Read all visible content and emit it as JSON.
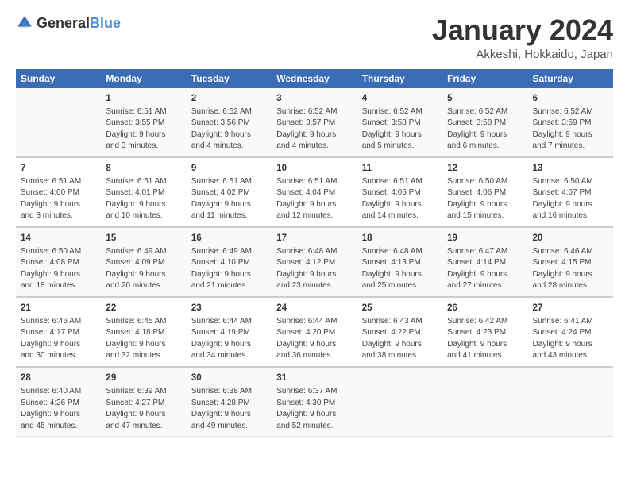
{
  "logo": {
    "text_general": "General",
    "text_blue": "Blue"
  },
  "header": {
    "month": "January 2024",
    "location": "Akkeshi, Hokkaido, Japan"
  },
  "weekdays": [
    "Sunday",
    "Monday",
    "Tuesday",
    "Wednesday",
    "Thursday",
    "Friday",
    "Saturday"
  ],
  "weeks": [
    [
      {
        "day": "",
        "info": ""
      },
      {
        "day": "1",
        "info": "Sunrise: 6:51 AM\nSunset: 3:55 PM\nDaylight: 9 hours\nand 3 minutes."
      },
      {
        "day": "2",
        "info": "Sunrise: 6:52 AM\nSunset: 3:56 PM\nDaylight: 9 hours\nand 4 minutes."
      },
      {
        "day": "3",
        "info": "Sunrise: 6:52 AM\nSunset: 3:57 PM\nDaylight: 9 hours\nand 4 minutes."
      },
      {
        "day": "4",
        "info": "Sunrise: 6:52 AM\nSunset: 3:58 PM\nDaylight: 9 hours\nand 5 minutes."
      },
      {
        "day": "5",
        "info": "Sunrise: 6:52 AM\nSunset: 3:58 PM\nDaylight: 9 hours\nand 6 minutes."
      },
      {
        "day": "6",
        "info": "Sunrise: 6:52 AM\nSunset: 3:59 PM\nDaylight: 9 hours\nand 7 minutes."
      }
    ],
    [
      {
        "day": "7",
        "info": "Sunrise: 6:51 AM\nSunset: 4:00 PM\nDaylight: 9 hours\nand 8 minutes."
      },
      {
        "day": "8",
        "info": "Sunrise: 6:51 AM\nSunset: 4:01 PM\nDaylight: 9 hours\nand 10 minutes."
      },
      {
        "day": "9",
        "info": "Sunrise: 6:51 AM\nSunset: 4:02 PM\nDaylight: 9 hours\nand 11 minutes."
      },
      {
        "day": "10",
        "info": "Sunrise: 6:51 AM\nSunset: 4:04 PM\nDaylight: 9 hours\nand 12 minutes."
      },
      {
        "day": "11",
        "info": "Sunrise: 6:51 AM\nSunset: 4:05 PM\nDaylight: 9 hours\nand 14 minutes."
      },
      {
        "day": "12",
        "info": "Sunrise: 6:50 AM\nSunset: 4:06 PM\nDaylight: 9 hours\nand 15 minutes."
      },
      {
        "day": "13",
        "info": "Sunrise: 6:50 AM\nSunset: 4:07 PM\nDaylight: 9 hours\nand 16 minutes."
      }
    ],
    [
      {
        "day": "14",
        "info": "Sunrise: 6:50 AM\nSunset: 4:08 PM\nDaylight: 9 hours\nand 18 minutes."
      },
      {
        "day": "15",
        "info": "Sunrise: 6:49 AM\nSunset: 4:09 PM\nDaylight: 9 hours\nand 20 minutes."
      },
      {
        "day": "16",
        "info": "Sunrise: 6:49 AM\nSunset: 4:10 PM\nDaylight: 9 hours\nand 21 minutes."
      },
      {
        "day": "17",
        "info": "Sunrise: 6:48 AM\nSunset: 4:12 PM\nDaylight: 9 hours\nand 23 minutes."
      },
      {
        "day": "18",
        "info": "Sunrise: 6:48 AM\nSunset: 4:13 PM\nDaylight: 9 hours\nand 25 minutes."
      },
      {
        "day": "19",
        "info": "Sunrise: 6:47 AM\nSunset: 4:14 PM\nDaylight: 9 hours\nand 27 minutes."
      },
      {
        "day": "20",
        "info": "Sunrise: 6:46 AM\nSunset: 4:15 PM\nDaylight: 9 hours\nand 28 minutes."
      }
    ],
    [
      {
        "day": "21",
        "info": "Sunrise: 6:46 AM\nSunset: 4:17 PM\nDaylight: 9 hours\nand 30 minutes."
      },
      {
        "day": "22",
        "info": "Sunrise: 6:45 AM\nSunset: 4:18 PM\nDaylight: 9 hours\nand 32 minutes."
      },
      {
        "day": "23",
        "info": "Sunrise: 6:44 AM\nSunset: 4:19 PM\nDaylight: 9 hours\nand 34 minutes."
      },
      {
        "day": "24",
        "info": "Sunrise: 6:44 AM\nSunset: 4:20 PM\nDaylight: 9 hours\nand 36 minutes."
      },
      {
        "day": "25",
        "info": "Sunrise: 6:43 AM\nSunset: 4:22 PM\nDaylight: 9 hours\nand 38 minutes."
      },
      {
        "day": "26",
        "info": "Sunrise: 6:42 AM\nSunset: 4:23 PM\nDaylight: 9 hours\nand 41 minutes."
      },
      {
        "day": "27",
        "info": "Sunrise: 6:41 AM\nSunset: 4:24 PM\nDaylight: 9 hours\nand 43 minutes."
      }
    ],
    [
      {
        "day": "28",
        "info": "Sunrise: 6:40 AM\nSunset: 4:26 PM\nDaylight: 9 hours\nand 45 minutes."
      },
      {
        "day": "29",
        "info": "Sunrise: 6:39 AM\nSunset: 4:27 PM\nDaylight: 9 hours\nand 47 minutes."
      },
      {
        "day": "30",
        "info": "Sunrise: 6:38 AM\nSunset: 4:28 PM\nDaylight: 9 hours\nand 49 minutes."
      },
      {
        "day": "31",
        "info": "Sunrise: 6:37 AM\nSunset: 4:30 PM\nDaylight: 9 hours\nand 52 minutes."
      },
      {
        "day": "",
        "info": ""
      },
      {
        "day": "",
        "info": ""
      },
      {
        "day": "",
        "info": ""
      }
    ]
  ]
}
